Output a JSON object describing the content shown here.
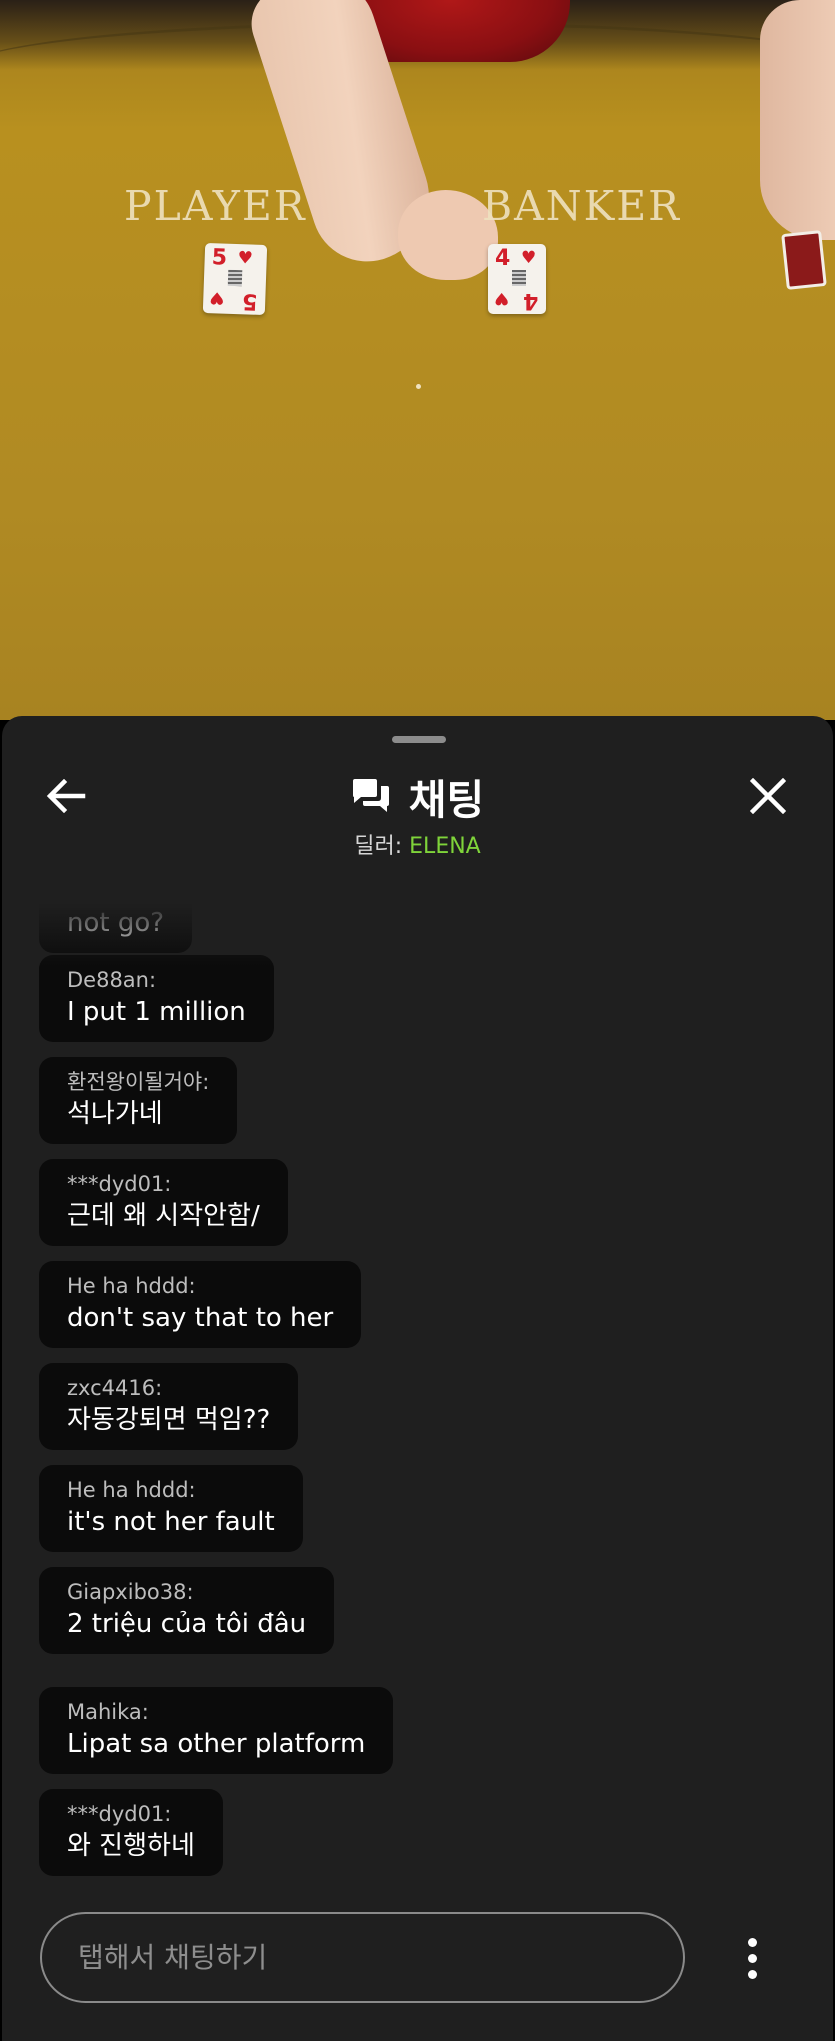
{
  "video": {
    "table_labels": {
      "player": "PLAYER",
      "banker": "BANKER"
    },
    "player_card": {
      "rank": "5",
      "suit": "♥"
    },
    "banker_card": {
      "rank": "4",
      "suit": "♥"
    }
  },
  "chat": {
    "title": "채팅",
    "dealer_label": "딜러: ",
    "dealer_name": "ELENA",
    "icons": {
      "back": "arrow-left-icon",
      "title": "chat-bubbles-icon",
      "close": "close-icon",
      "more": "more-vertical-icon"
    },
    "messages": [
      {
        "user": "",
        "text": "not go?"
      },
      {
        "user": "De88an:",
        "text": "I put 1 million"
      },
      {
        "user": "환전왕이될거야:",
        "text": "석나가네"
      },
      {
        "user": "***dyd01:",
        "text": "근데 왜 시작안함/"
      },
      {
        "user": "He ha hddd:",
        "text": "don't say that to her"
      },
      {
        "user": "zxc4416:",
        "text": "자동강퇴면 먹임??"
      },
      {
        "user": "He ha hddd:",
        "text": "it's not her fault"
      },
      {
        "user": "Giapxibo38:",
        "text": "2 triệu của tôi đâu"
      },
      {
        "user": "Mahika:",
        "text": "Lipat sa other platform"
      },
      {
        "user": "***dyd01:",
        "text": "와 진행하네"
      }
    ],
    "input_placeholder": "탭해서 채팅하기"
  }
}
